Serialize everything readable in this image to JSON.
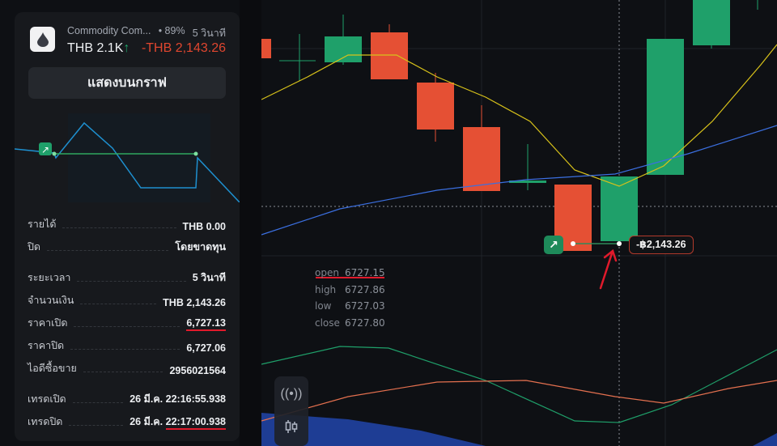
{
  "trade": {
    "asset_name": "Commodity Com...",
    "payout": "• 89%",
    "duration_short": "5 วินาที",
    "amount_short": "THB 2.1K",
    "direction_arrow": "↑",
    "result": "-THB 2,143.26",
    "show_on_chart": "แสดงบนกราฟ",
    "icon": "oil-drop-icon"
  },
  "details": [
    {
      "label": "รายได้",
      "value": "THB 0.00"
    },
    {
      "label": "ปิด",
      "value": "โดยขาดทุน"
    },
    {
      "label": "ระยะเวลา",
      "value": "5 วินาที"
    },
    {
      "label": "จำนวนเงิน",
      "value": "THB 2,143.26"
    },
    {
      "label": "ราคาเปิด",
      "value": "6,727.13"
    },
    {
      "label": "ราคาปิด",
      "value": "6,727.06"
    },
    {
      "label": "ไอดีซื้อขาย",
      "value": "2956021564"
    },
    {
      "label": "เทรดเปิด",
      "value": "26 มี.ค. 22:16:55.938"
    },
    {
      "label": "เทรดปิด",
      "date": "26 มี.ค.",
      "time": "22:17:00.938"
    }
  ],
  "ohlc": {
    "open_label": "open",
    "open": "6727.15",
    "high_label": "high",
    "high": "6727.86",
    "low_label": "low",
    "low": "6727.03",
    "close_label": "close",
    "close": "6727.80"
  },
  "chart": {
    "pl_tag": "-฿2,143.26",
    "direction_icon": "↗",
    "colors": {
      "up": "#1fa06a",
      "down": "#e55034",
      "ma_fast": "#d8c21a",
      "ma_slow": "#3b6fe0"
    }
  },
  "tools": {
    "signals_icon": "((•))",
    "candles_icon": "candlestick-icon"
  }
}
